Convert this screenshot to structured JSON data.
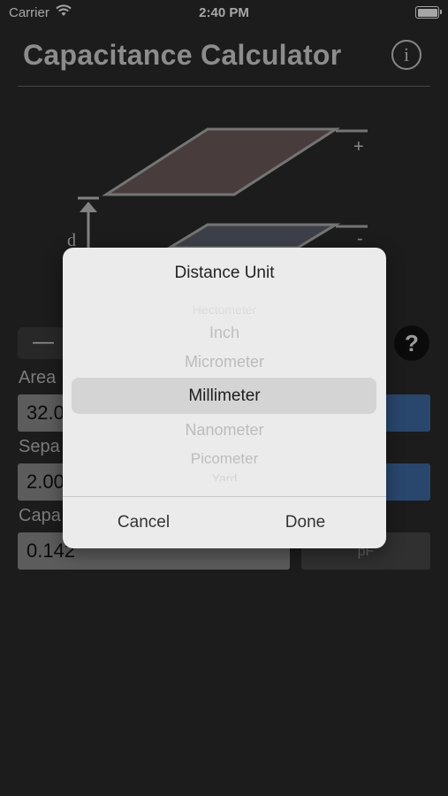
{
  "status_bar": {
    "carrier": "Carrier",
    "time": "2:40 PM"
  },
  "header": {
    "title": "Capacitance Calculator",
    "info_icon_label": "i"
  },
  "diagram": {
    "plus": "+",
    "minus": "-",
    "distance_label": "d"
  },
  "controls": {
    "minus_label": "—",
    "help_label": "?"
  },
  "fields": {
    "area": {
      "label": "Area",
      "value": "32.0"
    },
    "separation": {
      "label": "Sepa",
      "value": "2.00"
    },
    "capacitance": {
      "label": "Capa",
      "value": "0.142",
      "unit": "pF"
    }
  },
  "dialog": {
    "title": "Distance Unit",
    "options": [
      "Hectometer",
      "Inch",
      "Micrometer",
      "Millimeter",
      "Nanometer",
      "Picometer",
      "Yard"
    ],
    "selected": "Millimeter",
    "cancel_label": "Cancel",
    "done_label": "Done"
  },
  "colors": {
    "background": "#2b2b2b",
    "unit_button": "#3f6ea8",
    "dialog": "#ebebeb"
  }
}
